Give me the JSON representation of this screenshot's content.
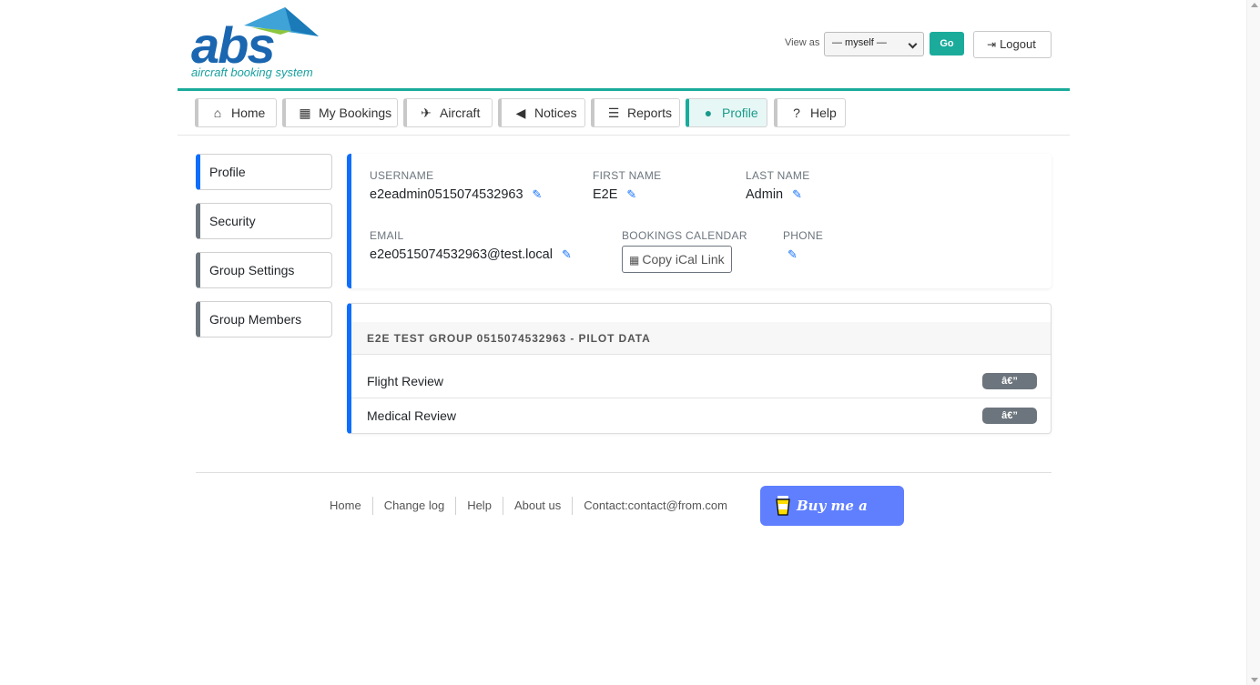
{
  "brand": {
    "logo_text": "abs",
    "logo_subtitle": "aircraft booking system"
  },
  "header": {
    "view_as_label": "View as",
    "view_as_selected": "— myself —",
    "go_label": "Go",
    "logout_label": "Logout"
  },
  "nav": {
    "tabs": [
      {
        "label": "Home",
        "icon": "home-icon"
      },
      {
        "label": "My Bookings",
        "icon": "calendar-check-icon"
      },
      {
        "label": "Aircraft",
        "icon": "plane-icon"
      },
      {
        "label": "Notices",
        "icon": "megaphone-icon"
      },
      {
        "label": "Reports",
        "icon": "chart-icon"
      },
      {
        "label": "Profile",
        "icon": "user-circle-icon",
        "active": true
      },
      {
        "label": "Help",
        "icon": "question-circle-icon"
      }
    ]
  },
  "sidebar": {
    "items": [
      {
        "label": "Profile",
        "active": true
      },
      {
        "label": "Security"
      },
      {
        "label": "Group Settings"
      },
      {
        "label": "Group Members"
      }
    ]
  },
  "profile": {
    "username_label": "USERNAME",
    "username": "e2eadmin0515074532963",
    "first_name_label": "FIRST NAME",
    "first_name": "E2E",
    "last_name_label": "LAST NAME",
    "last_name": "Admin",
    "email_label": "EMAIL",
    "email": "e2e0515074532963@test.local",
    "calendar_label": "BOOKINGS CALENDAR",
    "calendar_button": "Copy iCal Link",
    "phone_label": "PHONE",
    "phone": ""
  },
  "pilot_data": {
    "heading": "E2E TEST GROUP 0515074532963 - PILOT DATA",
    "rows": [
      {
        "label": "Flight Review",
        "badge": "â€”"
      },
      {
        "label": "Medical Review",
        "badge": "â€”"
      }
    ]
  },
  "footer": {
    "links": [
      "Home",
      "Change log",
      "Help",
      "About us",
      "Contact:contact@from.com"
    ],
    "coffee_label": "Buy me a coffee"
  },
  "colors": {
    "accent": "#1aab9b",
    "primary": "#0d6efd",
    "secondary": "#6c757d",
    "coffee": "#5f7fff"
  }
}
